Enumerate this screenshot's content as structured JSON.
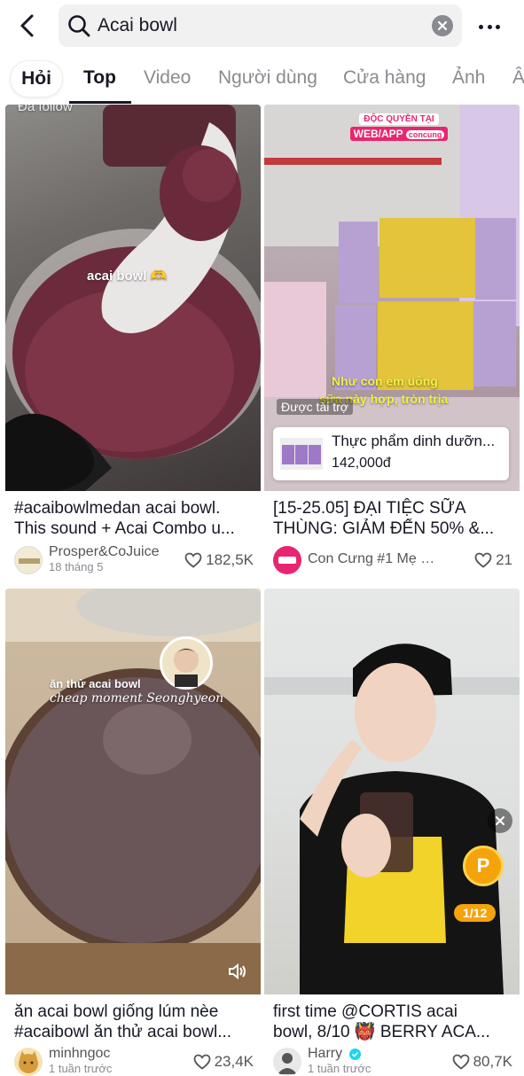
{
  "search": {
    "query": "Acai bowl"
  },
  "tabs": [
    {
      "label": "Hỏi"
    },
    {
      "label": "Top"
    },
    {
      "label": "Video"
    },
    {
      "label": "Người dùng"
    },
    {
      "label": "Cửa hàng"
    },
    {
      "label": "Ảnh"
    },
    {
      "label": "Â"
    }
  ],
  "videos": [
    {
      "overlay_top": "Đã follow",
      "overlay_center": "acai bowl 🫶",
      "caption_line1": "#acaibowlmedan acai bowl.",
      "caption_line2": "This sound + Acai Combo u...",
      "author": "Prosper&CoJuice",
      "date": "18 tháng 5",
      "likes": "182,5K"
    },
    {
      "banner_line1": "ĐỘC QUYỀN TẠI",
      "banner_line2": "WEB/APP",
      "banner_brand": "concung",
      "overlay_sub1": "Như con em uống",
      "overlay_sub2": "sữa này hợp, tròn trịa",
      "sponsored": "Được tài trợ",
      "product_name": "Thực phẩm dinh dưỡn...",
      "product_price": "142,000đ",
      "caption_line1": "[15-25.05] ĐẠI TIỆC SỮA",
      "caption_line2": "THÙNG: GIẢM ĐẾN 50% &...",
      "author": "Con Cưng #1 Mẹ và...",
      "likes": "21"
    },
    {
      "overlay_line1": "ăn thử acai bowl",
      "overlay_line2": "cheap moment Seonghyeon",
      "caption_line1": "ăn acai bowl giống lúm nèe",
      "caption_line2": "#acaibowl ăn thử acai bowl...",
      "author": "minhngoc",
      "date": "1 tuần trước",
      "likes": "23,4K"
    },
    {
      "counter": "1/12",
      "caption_line1": "first time @CORTIS acai",
      "caption_line2": "bowl, 8/10 👹 BERRY ACA...",
      "author": "Harry",
      "date": "1 tuần trước",
      "likes": "80,7K"
    }
  ],
  "colors": {
    "accent": "#fe2c55",
    "text": "#161823",
    "muted": "#8a8b91",
    "verified": "#20d5ec"
  }
}
